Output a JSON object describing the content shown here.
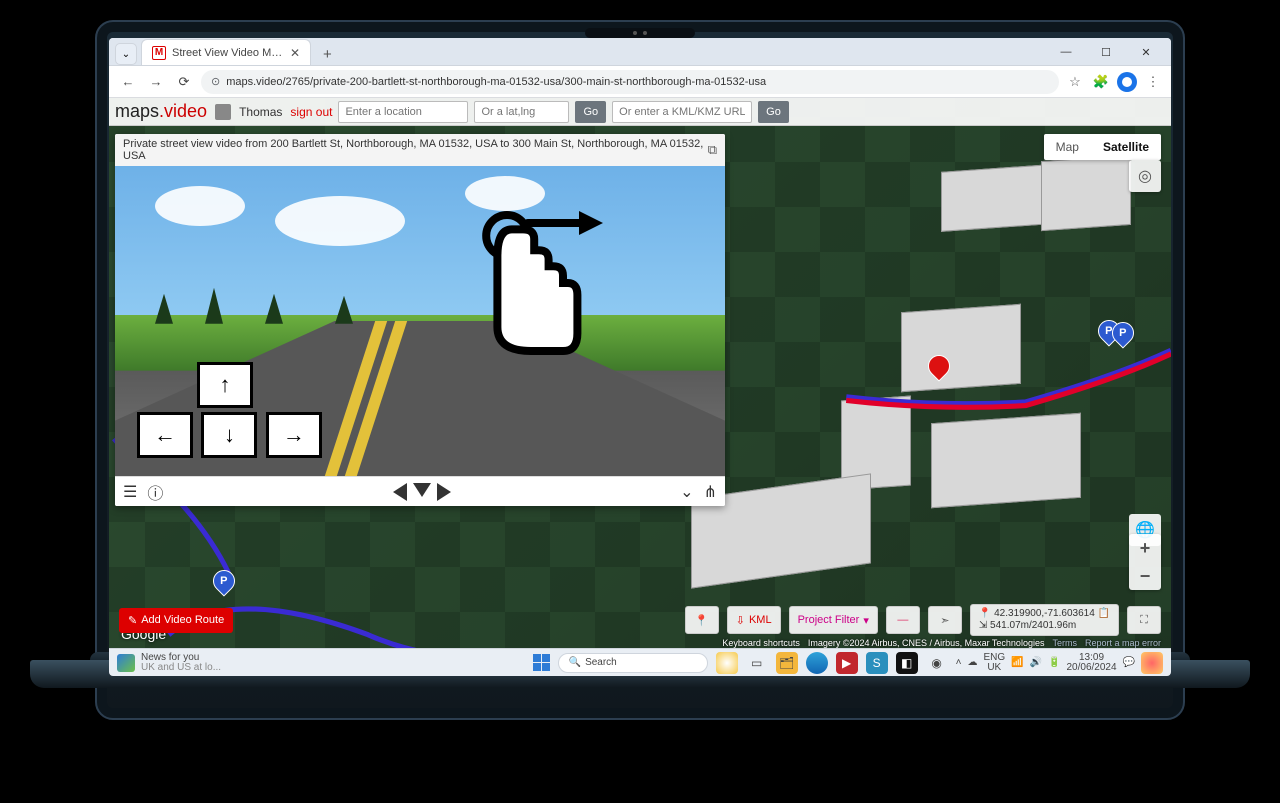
{
  "browser": {
    "tab_title": "Street View Video Map - maps...",
    "url": "maps.video/2765/private-200-bartlett-st-northborough-ma-01532-usa/300-main-st-northborough-ma-01532-usa"
  },
  "app": {
    "brand_prefix": "maps",
    "brand_suffix": ".video",
    "user_name": "Thomas",
    "sign_out": "sign out",
    "location_placeholder": "Enter a location",
    "latlng_placeholder": "Or a lat,lng",
    "kml_placeholder": "Or enter a KML/KMZ URL",
    "go": "Go",
    "maptype_map": "Map",
    "maptype_satellite": "Satellite"
  },
  "panel": {
    "title": "Private street view video from 200 Bartlett St, Northborough, MA 01532, USA to 300 Main St, Northborough, MA 01532, USA"
  },
  "bottom": {
    "add_route": "Add Video Route",
    "kml": "KML",
    "project_filter": "Project Filter",
    "coords": "42.319900,-71.603614",
    "elev": "541.07m/2401.96m"
  },
  "attribution": {
    "shortcuts": "Keyboard shortcuts",
    "imagery": "Imagery ©2024 Airbus, CNES / Airbus, Maxar Technologies",
    "terms": "Terms",
    "report": "Report a map error"
  },
  "google": "Google",
  "taskbar": {
    "news_title": "News for you",
    "news_sub": "UK and US at lo...",
    "search": "Search",
    "lang1": "ENG",
    "lang2": "UK",
    "time": "13:09",
    "date": "20/06/2024"
  }
}
